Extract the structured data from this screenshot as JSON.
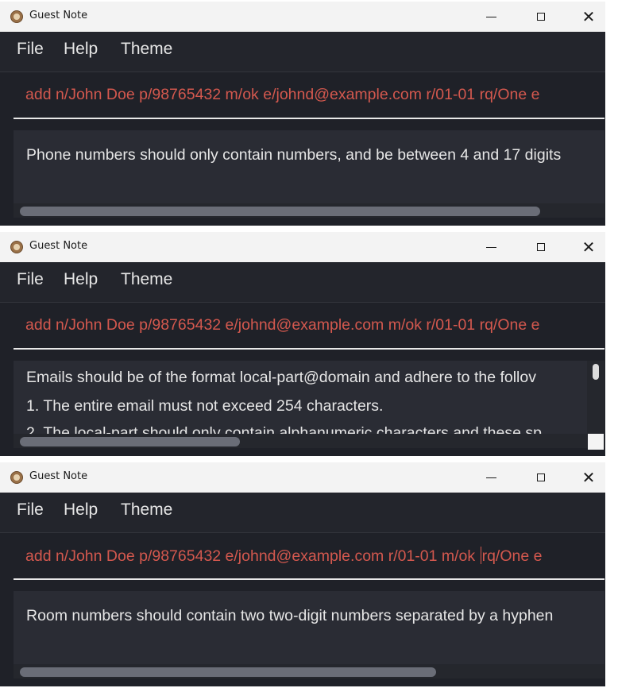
{
  "app_title": "Guest Note",
  "menu": [
    "File",
    "Help",
    "Theme"
  ],
  "window_controls": {
    "minimize": "—",
    "maximize": "☐",
    "close": "✕"
  },
  "panels": [
    {
      "command": "add n/John Doe p/98765432 m/ok e/johnd@example.com r/01-01 rq/One e",
      "result_lines": [
        "Phone numbers should only contain numbers, and be between 4 and 17 digits"
      ],
      "horizontal_scroll_fraction": 0.9
    },
    {
      "command": "add n/John Doe p/98765432 e/johnd@example.com m/ok r/01-01 rq/One e",
      "result_lines": [
        "Emails should be of the format local-part@domain and adhere to the follov",
        "1. The entire email must not exceed 254 characters.",
        "2. The local-part should only contain alphanumeric characters and these sp"
      ],
      "horizontal_scroll_fraction": 0.38
    },
    {
      "command_before_caret": "add n/John Doe p/98765432 e/johnd@example.com r/01-01  m/ok ",
      "command_after_caret": "rq/One e",
      "result_lines": [
        "Room numbers should contain two two-digit numbers separated by a hyphen"
      ],
      "horizontal_scroll_fraction": 0.72
    }
  ]
}
